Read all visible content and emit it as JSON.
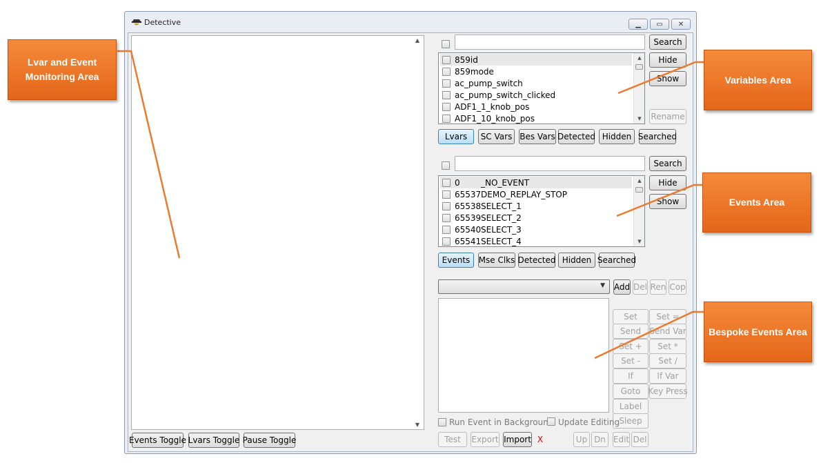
{
  "window": {
    "title": "Detective"
  },
  "variables": {
    "search_label": "Search",
    "hide_label": "Hide",
    "show_label": "Show",
    "rename_label": "Rename",
    "items": [
      "859id",
      "859mode",
      "ac_pump_switch",
      "ac_pump_switch_clicked",
      "ADF1_1_knob_pos",
      "ADF1_10_knob_pos"
    ],
    "tabs": [
      "Lvars",
      "SC Vars",
      "Bes Vars",
      "Detected",
      "Hidden",
      "Searched"
    ]
  },
  "events": {
    "search_label": "Search",
    "hide_label": "Hide",
    "show_label": "Show",
    "items": [
      {
        "id": "0",
        "name": "_NO_EVENT"
      },
      {
        "id": "65537",
        "name": "DEMO_REPLAY_STOP"
      },
      {
        "id": "65538",
        "name": "SELECT_1"
      },
      {
        "id": "65539",
        "name": "SELECT_2"
      },
      {
        "id": "65540",
        "name": "SELECT_3"
      },
      {
        "id": "65541",
        "name": "SELECT_4"
      }
    ],
    "tabs": [
      "Events",
      "Mse Clks",
      "Detected",
      "Hidden",
      "Searched"
    ]
  },
  "bespoke": {
    "top_buttons": [
      "Add",
      "Del",
      "Ren",
      "Cop"
    ],
    "grid": [
      [
        "Set",
        "Set ="
      ],
      [
        "Send",
        "Send Var"
      ],
      [
        "Set +",
        "Set *"
      ],
      [
        "Set -",
        "Set /"
      ],
      [
        "If",
        "If Var"
      ],
      [
        "Goto",
        "Key Press"
      ],
      [
        "Label"
      ],
      [
        "Sleep"
      ]
    ],
    "run_in_background": "Run Event in Background",
    "update_editing": "Update Editing",
    "bottom_buttons": [
      "Test",
      "Export",
      "Import"
    ],
    "close_x": "X",
    "nav_buttons": [
      "Up",
      "Dn",
      "Edit",
      "Del"
    ]
  },
  "monitor": {
    "bottom_buttons": [
      "Events Toggle",
      "Lvars Toggle",
      "Pause Toggle"
    ]
  },
  "callouts": {
    "monitoring": "Lvar and Event Monitoring Area",
    "variables": "Variables Area",
    "events": "Events Area",
    "bespoke": "Bespoke Events Area"
  },
  "colors": {
    "callout_orange": "#e9711f",
    "callout_line": "#ec7a2c",
    "active_tab": "#b9dff7",
    "red_x": "#dd0000"
  }
}
